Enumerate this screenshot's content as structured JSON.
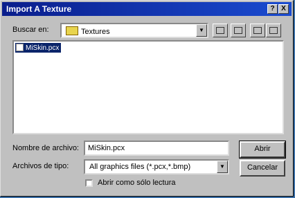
{
  "window": {
    "title": "Import A Texture",
    "help_label": "?",
    "close_label": "X"
  },
  "lookin": {
    "label": "Buscar en:",
    "value": "Textures"
  },
  "files": [
    {
      "name": "MiSkin.pcx",
      "selected": true
    }
  ],
  "filename": {
    "label": "Nombre de archivo:",
    "value": "MiSkin.pcx"
  },
  "filetype": {
    "label": "Archivos de tipo:",
    "value": "All graphics files (*.pcx,*.bmp)"
  },
  "buttons": {
    "open": "Abrir",
    "cancel": "Cancelar"
  },
  "readonly": {
    "label": "Abrir como sólo lectura",
    "checked": false
  },
  "colors": {
    "title_bar": "#0a1e8c",
    "selection": "#0a246a",
    "face": "#c0c0c0"
  }
}
